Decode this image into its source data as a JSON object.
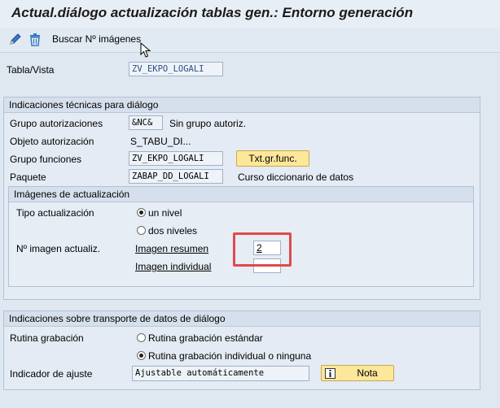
{
  "window": {
    "title": "Actual.diálogo actualización tablas gen.: Entorno generación"
  },
  "toolbar": {
    "edit_icon": "pencil-icon",
    "delete_icon": "trash-icon",
    "search_images_label": "Buscar Nº imágenes"
  },
  "header": {
    "table_label": "Tabla/Vista",
    "table_value": "ZV_EKPO_LOGALI"
  },
  "tech": {
    "title": "Indicaciones técnicas para diálogo",
    "auth_group_label": "Grupo autorizaciones",
    "auth_group_value": "&NC&",
    "auth_group_desc": "Sin grupo autoriz.",
    "auth_object_label": "Objeto autorización",
    "auth_object_value": "S_TABU_DI...",
    "func_group_label": "Grupo funciones",
    "func_group_value": "ZV_EKPO_LOGALI",
    "func_group_text_button": "Txt.gr.func.",
    "package_label": "Paquete",
    "package_value": "ZABAP_DD_LOGALI",
    "package_desc": "Curso diccionario de datos"
  },
  "images": {
    "title": "Imágenes de actualización",
    "type_label": "Tipo actualización",
    "option_one_level": "un nivel",
    "option_two_levels": "dos niveles",
    "selected_type": "un nivel",
    "number_label": "Nº imagen actualiz.",
    "summary_label": "Imagen resumen",
    "summary_value": "2",
    "individual_label": "Imagen individual",
    "individual_value": ""
  },
  "transport": {
    "title": "Indicaciones sobre transporte de datos de diálogo",
    "routine_label": "Rutina grabación",
    "option_standard": "Rutina grabación estándar",
    "option_individual": "Rutina grabación individual o ninguna",
    "selected_routine": "Rutina grabación individual o ninguna",
    "adjust_label": "Indicador de ajuste",
    "adjust_value": "Ajustable automáticamente",
    "note_button": "Nota"
  },
  "colors": {
    "background": "#dfe7f1",
    "button_yellow": "#fce79a",
    "highlight_red": "#e04a4a"
  }
}
